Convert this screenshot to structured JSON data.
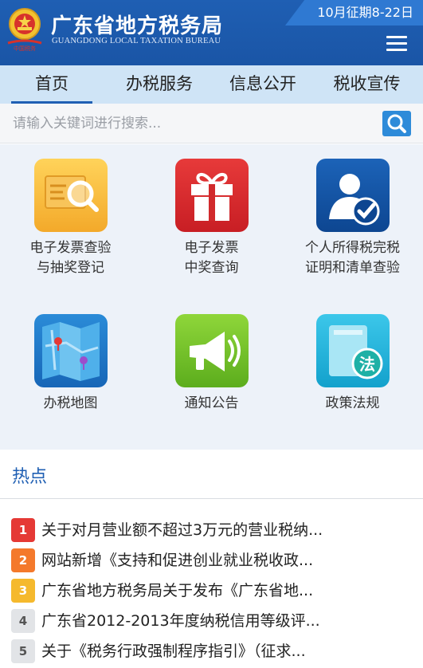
{
  "header": {
    "title": "广东省地方税务局",
    "subtitle": "GUANGDONG LOCAL TAXATION BUREAU",
    "period_notice": "10月征期8-22日",
    "emblem_icon": "national-emblem-icon",
    "menu_icon": "hamburger-menu-icon"
  },
  "nav": {
    "tabs": [
      {
        "label": "首页",
        "active": true
      },
      {
        "label": "办税服务",
        "active": false
      },
      {
        "label": "信息公开",
        "active": false
      },
      {
        "label": "税收宣传",
        "active": false
      }
    ]
  },
  "search": {
    "placeholder": "请输入关键词进行搜索...",
    "icon": "search-icon"
  },
  "services": [
    {
      "line1": "电子发票查验",
      "line2": "与抽奖登记",
      "icon": "invoice-search-icon"
    },
    {
      "line1": "电子发票",
      "line2": "中奖查询",
      "icon": "gift-icon"
    },
    {
      "line1": "个人所得税完税",
      "line2": "证明和清单查验",
      "icon": "person-check-icon"
    },
    {
      "line1": "办税地图",
      "line2": "",
      "icon": "map-icon"
    },
    {
      "line1": "通知公告",
      "line2": "",
      "icon": "megaphone-icon"
    },
    {
      "line1": "政策法规",
      "line2": "",
      "icon": "law-book-icon"
    }
  ],
  "hot": {
    "title": "热点",
    "items": [
      {
        "rank": "1",
        "text": "关于对月营业额不超过3万元的营业税纳...",
        "color": "#e53935"
      },
      {
        "rank": "2",
        "text": "网站新增《支持和促进创业就业税收政...",
        "color": "#f4792c"
      },
      {
        "rank": "3",
        "text": "广东省地方税务局关于发布《广东省地...",
        "color": "#f5b92d"
      },
      {
        "rank": "4",
        "text": "广东省2012-2013年度纳税信用等级评...",
        "color": "#e2e4e7"
      },
      {
        "rank": "5",
        "text": "关于《税务行政强制程序指引》（征求...",
        "color": "#e2e4e7"
      }
    ]
  },
  "colors": {
    "header_bg": "#1f5fb3",
    "nav_bg": "#cfe4f6",
    "accent": "#2e8bd9"
  }
}
